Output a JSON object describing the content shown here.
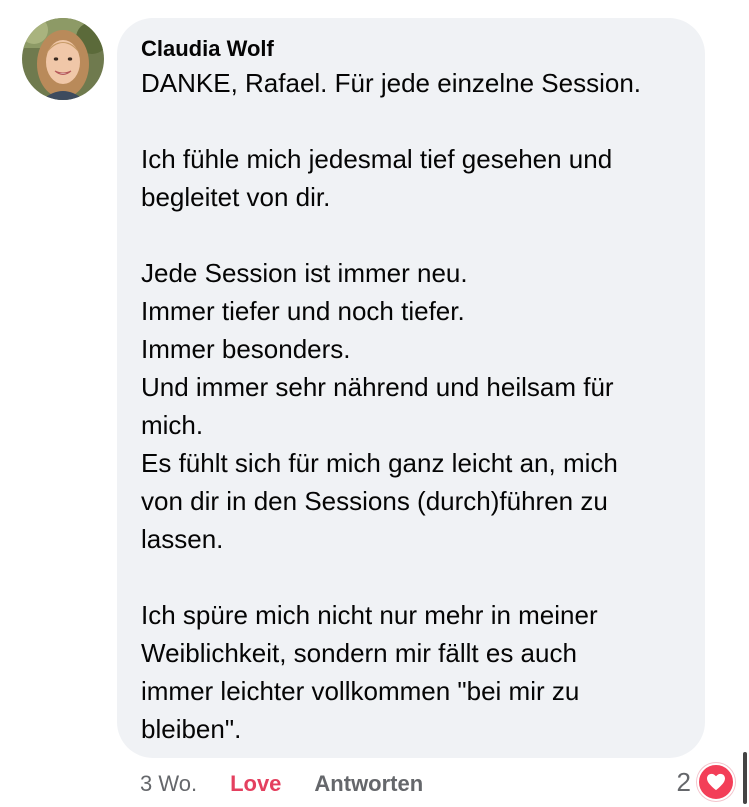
{
  "comment": {
    "author": "Claudia Wolf",
    "paragraphs": [
      [
        "DANKE, Rafael. Für jede einzelne Session."
      ],
      [
        "Ich fühle mich jedesmal tief gesehen und",
        "begleitet von dir."
      ],
      [
        "Jede Session ist immer neu.",
        "Immer tiefer und noch tiefer.",
        "Immer besonders.",
        "Und immer sehr nährend und heilsam für",
        "mich.",
        "Es fühlt sich für mich ganz leicht an, mich",
        "von dir in den Sessions (durch)führen zu",
        "lassen."
      ],
      [
        "Ich spüre mich nicht nur mehr in meiner",
        "Weiblichkeit, sondern mir fällt es auch",
        "immer leichter vollkommen \"bei mir zu",
        "bleiben\"."
      ]
    ]
  },
  "actions": {
    "time": "3 Wo.",
    "love_label": "Love",
    "reply_label": "Antworten"
  },
  "reactions": {
    "count": "2",
    "icon": "heart-icon"
  },
  "colors": {
    "bubble": "#f0f2f5",
    "love": "#e4405f",
    "heart": "#f33e58",
    "muted": "#65676b"
  }
}
